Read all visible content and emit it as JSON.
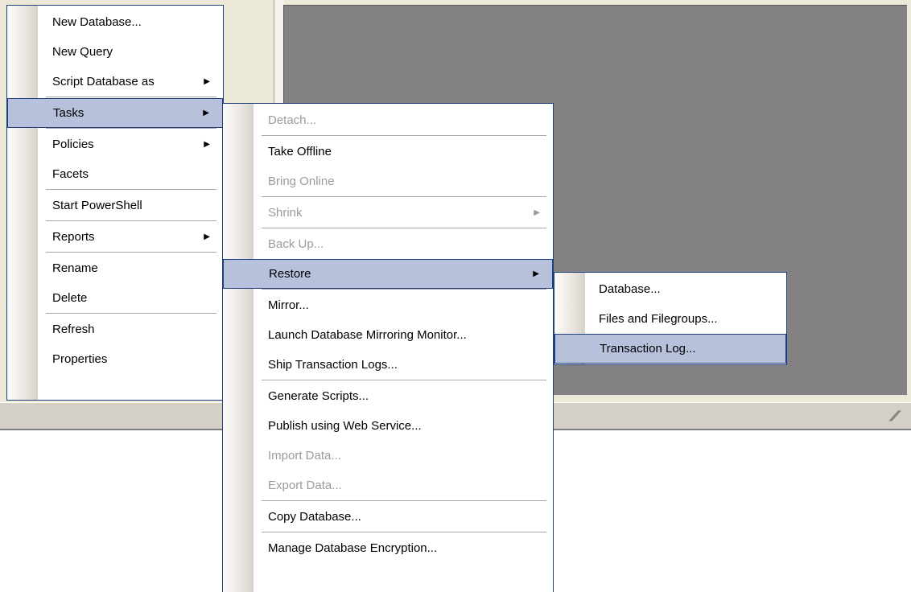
{
  "context_menu": {
    "items": [
      {
        "label": "New Database..."
      },
      {
        "label": "New Query"
      },
      {
        "label": "Script Database as",
        "submenu": true
      },
      {
        "label": "Tasks",
        "submenu": true,
        "highlighted": true
      },
      {
        "label": "Policies",
        "submenu": true
      },
      {
        "label": "Facets"
      },
      {
        "label": "Start PowerShell"
      },
      {
        "label": "Reports",
        "submenu": true
      },
      {
        "label": "Rename"
      },
      {
        "label": "Delete"
      },
      {
        "label": "Refresh"
      },
      {
        "label": "Properties"
      }
    ]
  },
  "tasks_menu": {
    "items": [
      {
        "label": "Detach...",
        "disabled": true
      },
      {
        "label": "Take Offline"
      },
      {
        "label": "Bring Online",
        "disabled": true
      },
      {
        "label": "Shrink",
        "disabled": true,
        "submenu": true
      },
      {
        "label": "Back Up...",
        "disabled": true
      },
      {
        "label": "Restore",
        "submenu": true,
        "highlighted": true
      },
      {
        "label": "Mirror..."
      },
      {
        "label": "Launch Database Mirroring Monitor..."
      },
      {
        "label": "Ship Transaction Logs..."
      },
      {
        "label": "Generate Scripts..."
      },
      {
        "label": "Publish using Web Service..."
      },
      {
        "label": "Import Data...",
        "disabled": true
      },
      {
        "label": "Export Data...",
        "disabled": true
      },
      {
        "label": "Copy Database..."
      },
      {
        "label": "Manage Database Encryption..."
      }
    ]
  },
  "restore_menu": {
    "items": [
      {
        "label": "Database..."
      },
      {
        "label": "Files and Filegroups..."
      },
      {
        "label": "Transaction Log...",
        "highlighted": true
      }
    ]
  },
  "icons": {
    "submenu_arrow": "▶",
    "resize_grip": "///"
  },
  "colors": {
    "highlight_bg": "#b7c1dc",
    "menu_border": "#1f3f7f",
    "disabled_text": "#9b9b9b",
    "workspace_bg": "#838184"
  }
}
